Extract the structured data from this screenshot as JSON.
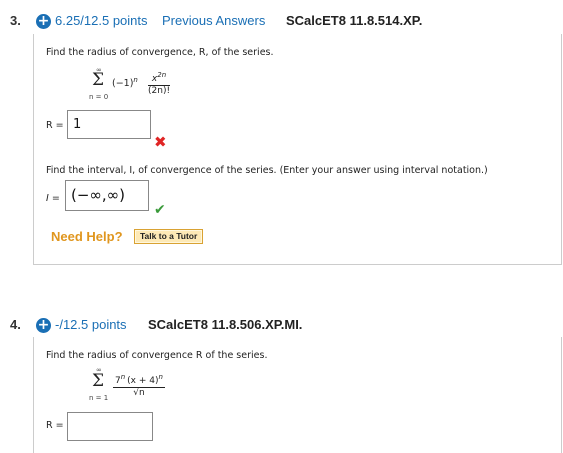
{
  "q3": {
    "number": "3.",
    "points": "6.25/12.5 points",
    "previous_answers": "Previous Answers",
    "code": "SCalcET8 11.8.514.XP.",
    "prompt_radius": "Find the radius of convergence, R, of the series.",
    "series": {
      "upper": "∞",
      "lower": "n = 0",
      "term": "(−1)",
      "term_exp": "n",
      "numerator": "x",
      "numerator_exp": "2n",
      "denominator": "(2n)!"
    },
    "radius_label": "R =",
    "radius_value": "1",
    "radius_status": "incorrect",
    "prompt_interval": "Find the interval, I, of convergence of the series. (Enter your answer using interval notation.)",
    "interval_label": "I =",
    "interval_value": "(−∞,∞)",
    "interval_status": "correct",
    "need_help": "Need Help?",
    "talk_to_tutor": "Talk to a Tutor"
  },
  "q4": {
    "number": "4.",
    "points": "-/12.5 points",
    "code": "SCalcET8 11.8.506.XP.MI.",
    "prompt": "Find the radius of convergence R of the series.",
    "series": {
      "upper": "∞",
      "lower": "n = 1",
      "numerator": "7",
      "numerator_exp": "n",
      "numerator_rest": "(x + 4)",
      "numerator_rest_exp": "n",
      "denominator": "√n"
    },
    "radius_label": "R =",
    "radius_value": ""
  },
  "colors": {
    "link_blue": "#1a6fb5",
    "help_orange": "#e0961e",
    "incorrect_red": "#e02525",
    "correct_green": "#3a9a3a"
  }
}
